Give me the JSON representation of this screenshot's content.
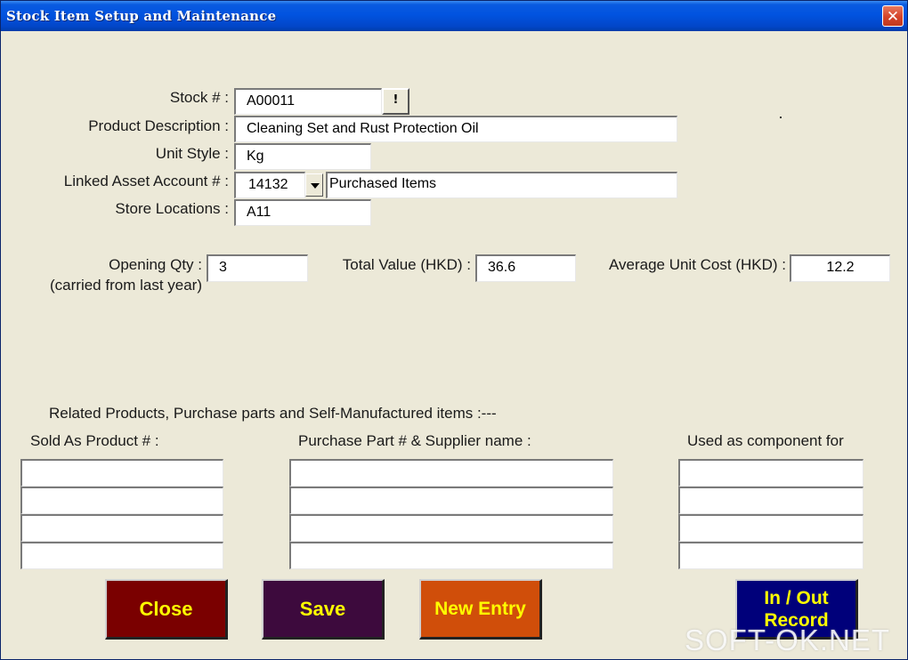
{
  "window": {
    "title": "Stock Item Setup and Maintenance",
    "close_glyph": "✕"
  },
  "form": {
    "stock_no": {
      "label": "Stock # :",
      "value": "A00011",
      "lookup_label": "!"
    },
    "product_description": {
      "label": "Product Description :",
      "value": "Cleaning Set and Rust Protection Oil"
    },
    "unit_style": {
      "label": "Unit Style :",
      "value": "Kg"
    },
    "linked_asset_account": {
      "label": "Linked Asset Account # :",
      "value": "14132",
      "account_name": "Purchased Items"
    },
    "store_locations": {
      "label": "Store Locations :",
      "value": "A11"
    },
    "opening_qty": {
      "label": "Opening Qty :",
      "sublabel": "(carried from last year)",
      "value": "3"
    },
    "total_value": {
      "label": "Total Value (HKD) :",
      "value": "36.6"
    },
    "average_unit_cost": {
      "label": "Average Unit Cost (HKD) :",
      "value": "12.2"
    }
  },
  "related": {
    "heading": "Related Products, Purchase parts and Self-Manufactured items :---",
    "sold_as_label": "Sold As Product # :",
    "purchase_part_label": "Purchase Part # & Supplier name :",
    "component_label": "Used as component for"
  },
  "buttons": {
    "close": "Close",
    "save": "Save",
    "new_entry": "New Entry",
    "in_out_line1": "In / Out",
    "in_out_line2": "Record"
  },
  "colors": {
    "close_bg": "#7a0000",
    "save_bg": "#3d0a3d",
    "new_entry_bg": "#d04e0a",
    "in_out_bg": "#00007a",
    "button_text": "#ffff00"
  },
  "watermark": "SOFT-OK.NET"
}
